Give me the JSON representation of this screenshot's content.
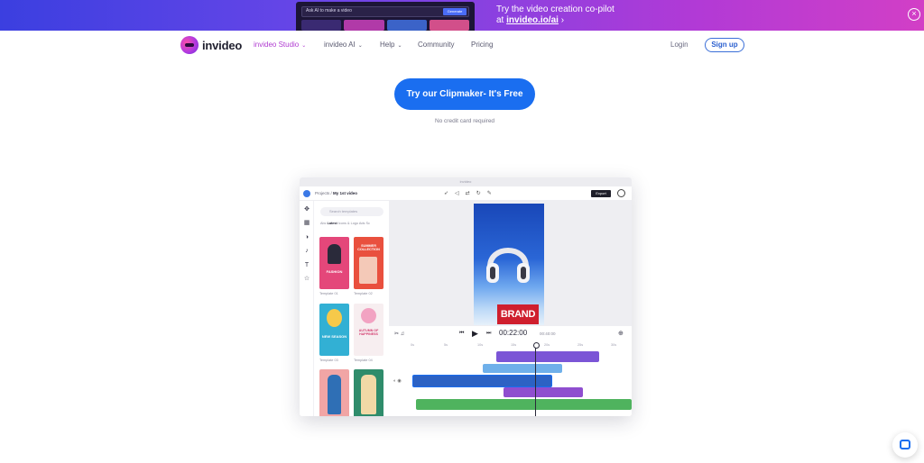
{
  "promo": {
    "thumb_input": "Ask AI to make a video",
    "thumb_button": "Generate",
    "line1": "Try the video creation co-pilot",
    "line2_prefix": "at ",
    "line2_link": "invideo.io/ai",
    "line2_suffix": " ›",
    "close_symbol": "×"
  },
  "nav": {
    "logo": "invideo",
    "items": [
      {
        "label": "invideo Studio",
        "chevron": "⌄"
      },
      {
        "label": "invideo AI",
        "chevron": "⌄"
      },
      {
        "label": "Help",
        "chevron": "⌄"
      },
      {
        "label": "Community",
        "chevron": ""
      },
      {
        "label": "Pricing",
        "chevron": ""
      }
    ],
    "login": "Login",
    "signup": "Sign up"
  },
  "hero": {
    "cta": "Try our Clipmaker- It's Free",
    "sub": "No credit card required"
  },
  "mockup": {
    "window_title": "invideo",
    "crumb_root": "Projects",
    "crumb_sep": " / ",
    "crumb_current": "My 1st video",
    "export": "Export",
    "search_placeholder": "Search templates",
    "categories_first": "Abc",
    "categories_active": "Latest",
    "categories_rest": "Icons & Logo   Ads   Sc",
    "templates": [
      {
        "label": "Template 01"
      },
      {
        "label": "Template 02"
      },
      {
        "label": "Template 03"
      },
      {
        "label": "Template 04"
      }
    ],
    "tpl1_text": "FASHION",
    "tpl2_text": "SUMMER COLLECTION",
    "tpl3_text": "NEW SEASON",
    "tpl4_text": "AUTUMN OF HAPPINESS",
    "canvas_brand": "BRAND",
    "time_current": "00:22:00",
    "time_total": "00:40:00",
    "ruler": [
      "0s",
      "5s",
      "10s",
      "15s",
      "20s",
      "25s",
      "30s"
    ],
    "playback": {
      "prev": "⏮",
      "play": "▶",
      "next": "⏭"
    }
  },
  "colors": {
    "accent": "#1a6ef0",
    "studio_active": "#b03cd1",
    "track_purple": "#7b55d6",
    "track_blue": "#2c62c4",
    "track_green": "#4fb35e",
    "brand_red": "#cf1f2e"
  },
  "icons": {
    "close": "close-icon",
    "chevron": "chevron-down-icon",
    "chat": "chat-icon"
  }
}
